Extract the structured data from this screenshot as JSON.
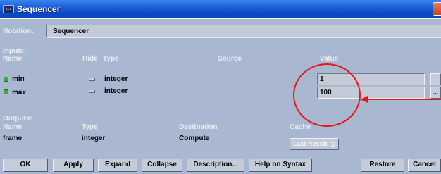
{
  "window": {
    "title": "Sequencer",
    "icon": "sequencer-window-icon"
  },
  "notation": {
    "label": "Notation:",
    "value": "Sequencer"
  },
  "inputs": {
    "section_label": "Inputs:",
    "headers": {
      "name": "Name",
      "hide": "Hide",
      "type": "Type",
      "source": "Source",
      "value": "Value"
    },
    "rows": [
      {
        "name": "min",
        "type": "integer",
        "value": "1",
        "checked": true,
        "hidden": false
      },
      {
        "name": "max",
        "type": "integer",
        "value": "100",
        "checked": true,
        "hidden": false
      }
    ]
  },
  "outputs": {
    "section_label": "Outputs:",
    "headers": {
      "name": "Name",
      "type": "Type",
      "destination": "Destination",
      "cache": "Cache"
    },
    "rows": [
      {
        "name": "frame",
        "type": "integer",
        "destination": "Compute",
        "cache": "Last Result"
      }
    ]
  },
  "buttons": {
    "ok": "OK",
    "apply": "Apply",
    "expand": "Expand",
    "collapse": "Collapse",
    "description": "Description...",
    "help": "Help on Syntax",
    "restore": "Restore",
    "cancel": "Cancel"
  },
  "field_button": "...",
  "dropdown_arrow": "⊒",
  "colors": {
    "titlebar": "#0a48c8",
    "panel": "#a9b8d0",
    "annotation": "#e41717",
    "checkbox": "#3faa3a"
  }
}
